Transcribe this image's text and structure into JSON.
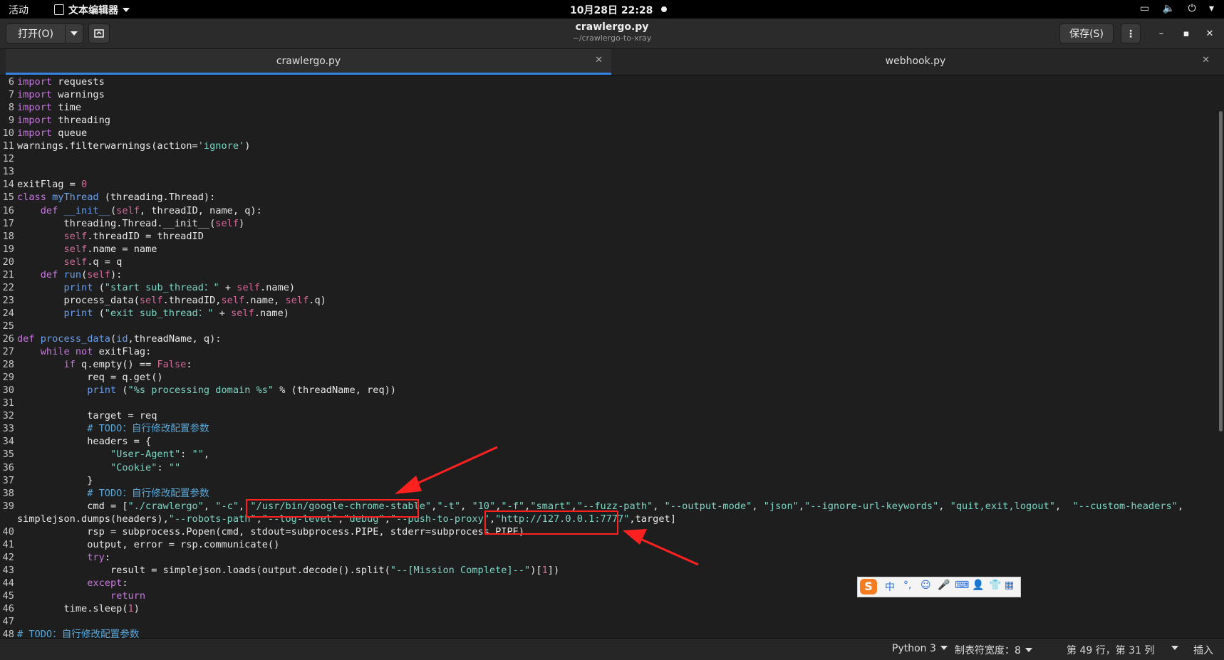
{
  "topbar": {
    "activities": "活动",
    "app_name": "文本编辑器",
    "datetime": "10月28日 22:28"
  },
  "header": {
    "open_label": "打开(O)",
    "title": "crawlergo.py",
    "subtitle": "~/crawlergo-to-xray",
    "save_label": "保存(S)"
  },
  "tabs": [
    {
      "label": "crawlergo.py",
      "active": true
    },
    {
      "label": "webhook.py",
      "active": false
    }
  ],
  "editor": {
    "lines": [
      {
        "n": "6",
        "html": "<span class='k'>import</span> requests"
      },
      {
        "n": "7",
        "html": "<span class='k'>import</span> warnings"
      },
      {
        "n": "8",
        "html": "<span class='k'>import</span> time"
      },
      {
        "n": "9",
        "html": "<span class='k'>import</span> threading"
      },
      {
        "n": "10",
        "html": "<span class='k'>import</span> queue"
      },
      {
        "n": "11",
        "html": "warnings.filterwarnings(action=<span class='s'>'ignore'</span>)"
      },
      {
        "n": "12",
        "html": ""
      },
      {
        "n": "13",
        "html": ""
      },
      {
        "n": "14",
        "html": "exitFlag = <span class='n'>0</span>"
      },
      {
        "n": "15",
        "html": "<span class='k'>class</span> <span class='f'>myThread</span> (threading.Thread):"
      },
      {
        "n": "16",
        "html": "    <span class='k'>def</span> <span class='f'>__init__</span>(<span class='n'>self</span>, threadID, name, q):"
      },
      {
        "n": "17",
        "html": "        threading.Thread.__init__(<span class='n'>self</span>)"
      },
      {
        "n": "18",
        "html": "        <span class='n'>self</span>.threadID = threadID"
      },
      {
        "n": "19",
        "html": "        <span class='n'>self</span>.name = name"
      },
      {
        "n": "20",
        "html": "        <span class='n'>self</span>.q = q"
      },
      {
        "n": "21",
        "html": "    <span class='k'>def</span> <span class='f'>run</span>(<span class='n'>self</span>):"
      },
      {
        "n": "22",
        "html": "        <span class='f'>print</span> (<span class='s'>\"start sub_thread：\"</span> + <span class='n'>self</span>.name)"
      },
      {
        "n": "23",
        "html": "        process_data(<span class='n'>self</span>.threadID,<span class='n'>self</span>.name, <span class='n'>self</span>.q)"
      },
      {
        "n": "24",
        "html": "        <span class='f'>print</span> (<span class='s'>\"exit sub_thread：\"</span> + <span class='n'>self</span>.name)"
      },
      {
        "n": "25",
        "html": ""
      },
      {
        "n": "26",
        "html": "<span class='k'>def</span> <span class='f'>process_data</span>(<span class='f'>id</span>,threadName, q):"
      },
      {
        "n": "27",
        "html": "    <span class='k'>while</span> <span class='k'>not</span> exitFlag:"
      },
      {
        "n": "28",
        "html": "        <span class='k'>if</span> q.empty() == <span class='n'>False</span>:"
      },
      {
        "n": "29",
        "html": "            req = q.get()"
      },
      {
        "n": "30",
        "html": "            <span class='f'>print</span> (<span class='s'>\"%s processing domain %s\"</span> % (threadName, req))"
      },
      {
        "n": "31",
        "html": ""
      },
      {
        "n": "32",
        "html": "            target = req"
      },
      {
        "n": "33",
        "html": "            <span class='c'># TODO：自行修改配置参数</span>"
      },
      {
        "n": "34",
        "html": "            headers = {"
      },
      {
        "n": "35",
        "html": "                <span class='s'>\"User-Agent\"</span>: <span class='s'>\"\"</span>,"
      },
      {
        "n": "36",
        "html": "                <span class='s'>\"Cookie\"</span>: <span class='s'>\"\"</span>"
      },
      {
        "n": "37",
        "html": "            }"
      },
      {
        "n": "38",
        "html": "            <span class='c'># TODO：自行修改配置参数</span>"
      },
      {
        "n": "39",
        "html": "            cmd = [<span class='s'>\"./crawlergo\"</span>, <span class='s'>\"-c\"</span>, <span class='s'>\"/usr/bin/google-chrome-stable\"</span>,<span class='s'>\"-t\"</span>, <span class='s'>\"10\"</span>,<span class='s'>\"-f\"</span>,<span class='s'>\"smart\"</span>,<span class='s'>\"--fuzz-path\"</span>, <span class='s'>\"--output-mode\"</span>, <span class='s'>\"json\"</span>,<span class='s'>\"--ignore-url-keywords\"</span>, <span class='s'>\"quit,exit,logout\"</span>,  <span class='s'>\"--custom-headers\"</span>,"
      },
      {
        "n": "",
        "html": "simplejson.dumps(headers),<span class='s'>\"--robots-path\"</span>,<span class='s'>\"--log-level\"</span>,<span class='s'>\"debug\"</span>,<span class='s'>\"--push-to-proxy\"</span>,<span class='s'>\"http://127.0.0.1:7777\"</span>,target]"
      },
      {
        "n": "40",
        "html": "            rsp = subprocess.Popen(cmd, stdout=subprocess.PIPE, stderr=subprocess.PIPE)"
      },
      {
        "n": "41",
        "html": "            output, error = rsp.communicate()"
      },
      {
        "n": "42",
        "html": "            <span class='k'>try</span>:"
      },
      {
        "n": "43",
        "html": "                result = simplejson.loads(output.decode().split(<span class='s'>\"--[Mission Complete]--\"</span>)[<span class='n'>1</span>])"
      },
      {
        "n": "44",
        "html": "            <span class='k'>except</span>:"
      },
      {
        "n": "45",
        "html": "                <span class='k'>return</span>"
      },
      {
        "n": "46",
        "html": "        time.sleep(<span class='n'>1</span>)"
      },
      {
        "n": "47",
        "html": ""
      },
      {
        "n": "48",
        "html": "<span class='c'># TODO：自行修改配置参数</span>"
      }
    ]
  },
  "ime": {
    "logo": "S",
    "items": [
      "中",
      "°,",
      "☺",
      "🎤",
      "⌨",
      "👤",
      "👕",
      "▦"
    ]
  },
  "statusbar": {
    "language": "Python 3",
    "tab_width": "制表符宽度：8",
    "cursor_pos": "第 49 行，第 31 列",
    "insert_mode": "插入"
  }
}
